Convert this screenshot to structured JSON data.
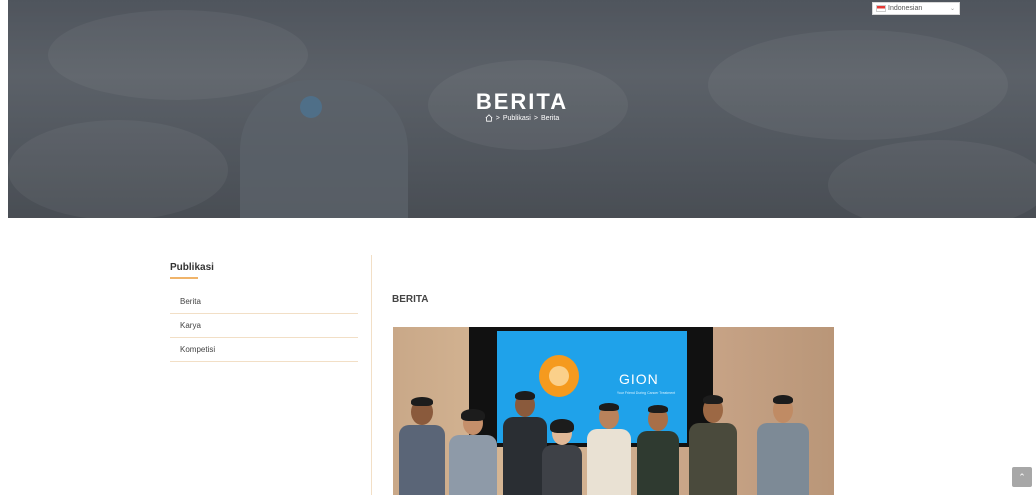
{
  "language_select": {
    "selected": "Indonesian"
  },
  "hero": {
    "title": "BERITA",
    "breadcrumb": [
      "Publikasi",
      "Berita"
    ],
    "separator": ">"
  },
  "sidebar": {
    "title": "Publikasi",
    "items": [
      {
        "label": "Berita"
      },
      {
        "label": "Karya"
      },
      {
        "label": "Kompetisi"
      }
    ]
  },
  "main": {
    "title": "BERITA",
    "photo": {
      "screen_title": "GION",
      "screen_subtitle": "Your Friend During Cancer Treatment"
    }
  },
  "colors": {
    "accent_underline": "#f0b46a",
    "divider": "#f2dfc6",
    "scroll_button": "#a7a7a7"
  },
  "icons": {
    "home": "home-icon",
    "scroll_top": "chevron-up-icon",
    "lang_caret": "chevron-down-icon"
  }
}
